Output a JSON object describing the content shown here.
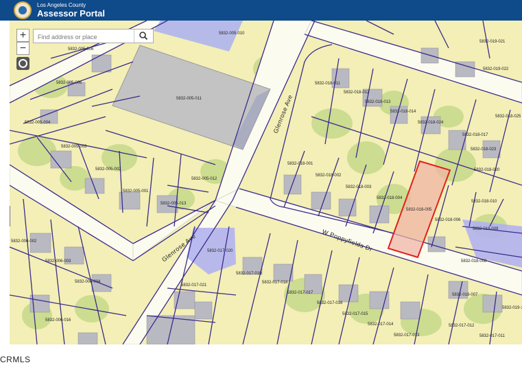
{
  "header": {
    "agency": "Los Angeles County",
    "title": "Assessor Portal"
  },
  "search": {
    "placeholder": "Find address or place"
  },
  "controls": {
    "zoom_in": "+",
    "zoom_out": "−"
  },
  "icons": {
    "seal": "county-seal-icon",
    "search": "search-icon",
    "locate": "locate-icon"
  },
  "colors": {
    "header": "#0f4a8a",
    "parcel_line": "#3b2a8a",
    "selected": "#e0201c",
    "highlight": "#aeb4ee"
  },
  "streets": [
    "Glenrose Ave",
    "Glenrose Ave",
    "W Poppyfields Dr"
  ],
  "parcels": [
    "5832-005-010",
    "5832-005-006",
    "5832-005-005",
    "5832-005-011",
    "5832-005-004",
    "5832-005-003",
    "5832-005-002",
    "5832-005-001",
    "5832-005-012",
    "5832-005-013",
    "5832-018-011",
    "5832-018-012",
    "5832-018-013",
    "5832-018-014",
    "5832-018-024",
    "5832-018-017",
    "5832-018-023",
    "5832-018-020",
    "5832-018-001",
    "5832-018-002",
    "5832-018-003",
    "5832-018-004",
    "5832-018-005",
    "5832-018-006",
    "5832-018-010",
    "5832-018-009",
    "5832-018-008",
    "5832-018-007",
    "5832-019-021",
    "5832-019-022",
    "5832-018-025",
    "5832-006-002",
    "5832-006-003",
    "5832-006-004",
    "5832-006-016",
    "5832-017-020",
    "5832-017-019",
    "5832-017-018",
    "5832-017-017",
    "5832-017-016",
    "5832-017-015",
    "5832-017-014",
    "5832-017-013",
    "5832-017-012",
    "5832-017-011",
    "5832-017-021",
    "5832-019-18"
  ],
  "footer": "CRMLS"
}
